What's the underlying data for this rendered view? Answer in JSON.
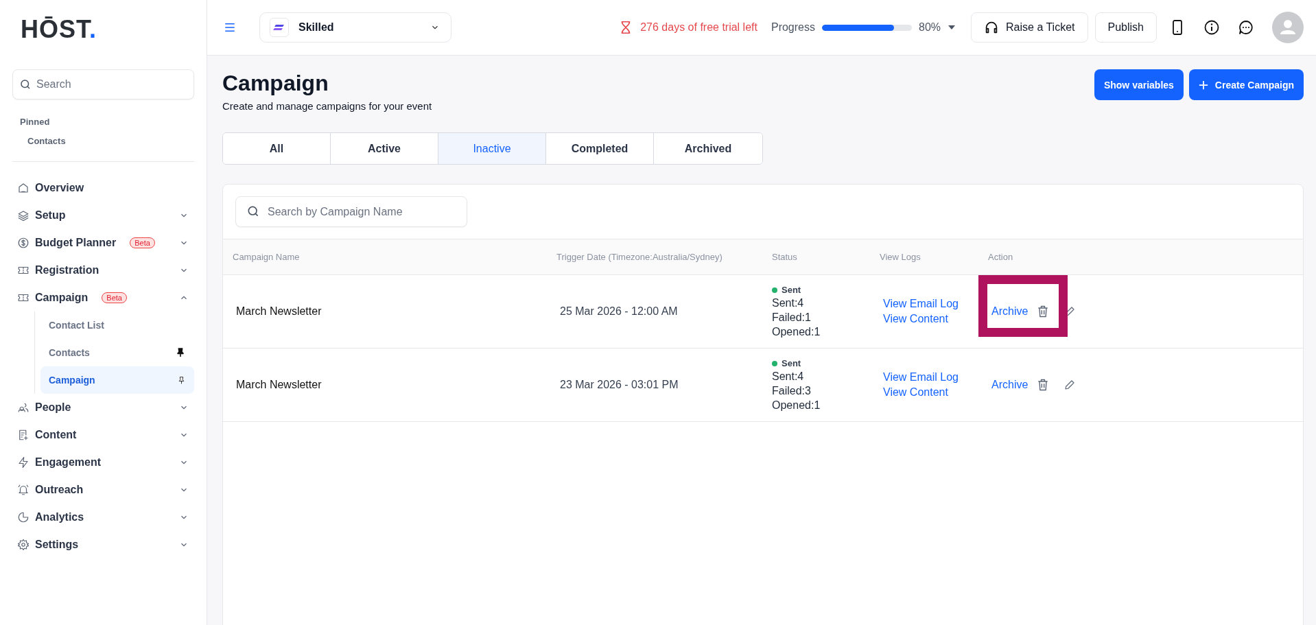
{
  "logo": {
    "text": "HŌST",
    "dot": "."
  },
  "sidebar": {
    "search": {
      "placeholder": "Search"
    },
    "pinned": {
      "title": "Pinned",
      "items": [
        "Contacts"
      ]
    },
    "items": [
      {
        "label": "Overview"
      },
      {
        "label": "Setup",
        "expanded": false
      },
      {
        "label": "Budget Planner",
        "badge": "Beta",
        "expanded": false
      },
      {
        "label": "Registration",
        "expanded": false
      },
      {
        "label": "Campaign",
        "badge": "Beta",
        "expanded": true,
        "children": [
          {
            "label": "Contact List",
            "selected": false
          },
          {
            "label": "Contacts",
            "selected": false,
            "pinned": true
          },
          {
            "label": "Campaign",
            "selected": true,
            "pinned": false
          }
        ]
      },
      {
        "label": "People",
        "expanded": false
      },
      {
        "label": "Content",
        "expanded": false
      },
      {
        "label": "Engagement",
        "expanded": false
      },
      {
        "label": "Outreach",
        "expanded": false
      },
      {
        "label": "Analytics",
        "expanded": false
      },
      {
        "label": "Settings",
        "expanded": false
      }
    ]
  },
  "topbar": {
    "event": "Skilled",
    "trial": "276 days of free trial left",
    "progress": {
      "label": "Progress",
      "level": 0.8,
      "reading": "80%"
    },
    "buttons": [
      "Raise a Ticket",
      "Publish"
    ]
  },
  "page": {
    "title": "Campaign",
    "subtitle": "Create and manage campaigns for your event",
    "buttons": [
      "Show variables",
      "Create Campaign"
    ]
  },
  "tabs": [
    {
      "label": "All",
      "selected": false
    },
    {
      "label": "Active",
      "selected": false
    },
    {
      "label": "Inactive",
      "selected": true
    },
    {
      "label": "Completed",
      "selected": false
    },
    {
      "label": "Archived",
      "selected": false
    }
  ],
  "table": {
    "search": {
      "placeholder": "Search by Campaign Name"
    },
    "columns": [
      "Campaign Name",
      "Trigger Date (Timezone:Australia/Sydney)",
      "Status",
      "View Logs",
      "Action"
    ],
    "rows": [
      {
        "name": "March Newsletter",
        "date": "25 Mar 2026 - 12:00 AM",
        "status": "Sent",
        "color": "#22b26b",
        "stats": [
          "Sent:4",
          "Failed:1",
          "Opened:1"
        ],
        "logs": [
          "View Email Log",
          "View Content"
        ],
        "action": "Archive",
        "highlighted": true
      },
      {
        "name": "March Newsletter",
        "date": "23 Mar 2026 - 03:01 PM",
        "status": "Sent",
        "color": "#22b26b",
        "stats": [
          "Sent:4",
          "Failed:3",
          "Opened:1"
        ],
        "logs": [
          "View Email Log",
          "View Content"
        ],
        "action": "Archive",
        "highlighted": false
      }
    ]
  }
}
